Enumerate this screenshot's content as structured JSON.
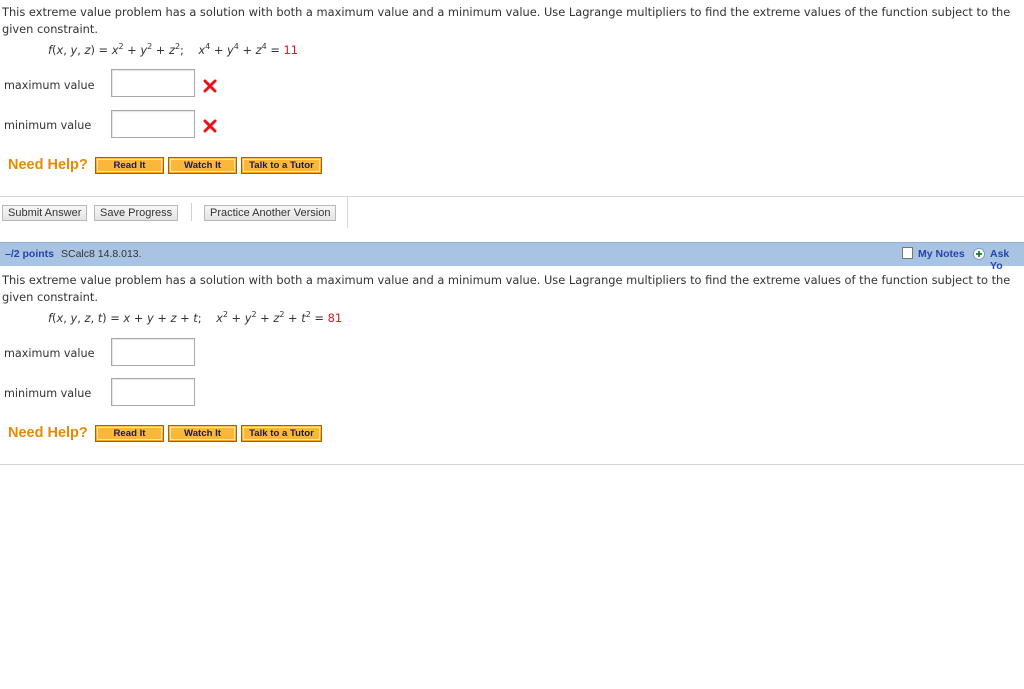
{
  "question1": {
    "prompt": "This extreme value problem has a solution with both a maximum value and a minimum value. Use Lagrange multipliers to find the extreme values of the function subject to the given constraint.",
    "function_lhs": "f(x, y, z) = x",
    "constraint_value": "11",
    "fields": [
      {
        "label": "maximum value",
        "value": "",
        "status": "incorrect"
      },
      {
        "label": "minimum value",
        "value": "",
        "status": "incorrect"
      }
    ],
    "need_help": "Need Help?",
    "help_buttons": [
      "Read It",
      "Watch It",
      "Talk to a Tutor"
    ]
  },
  "actions": {
    "submit": "Submit Answer",
    "save": "Save Progress",
    "practice": "Practice Another Version"
  },
  "question2": {
    "points": "–/2 points",
    "id": "SCalc8 14.8.013.",
    "my_notes": "My Notes",
    "ask": "Ask Yo",
    "prompt": "This extreme value problem has a solution with both a maximum value and a minimum value. Use Lagrange multipliers to find the extreme values of the function subject to the given constraint.",
    "constraint_value": "81",
    "fields": [
      {
        "label": "maximum value",
        "value": ""
      },
      {
        "label": "minimum value",
        "value": ""
      }
    ],
    "need_help": "Need Help?",
    "help_buttons": [
      "Read It",
      "Watch It",
      "Talk to a Tutor"
    ]
  },
  "colors": {
    "accent_orange": "#e88a00",
    "error_red": "#e8131a",
    "header_blue": "#a9c4e2",
    "link_blue": "#2545a8"
  }
}
